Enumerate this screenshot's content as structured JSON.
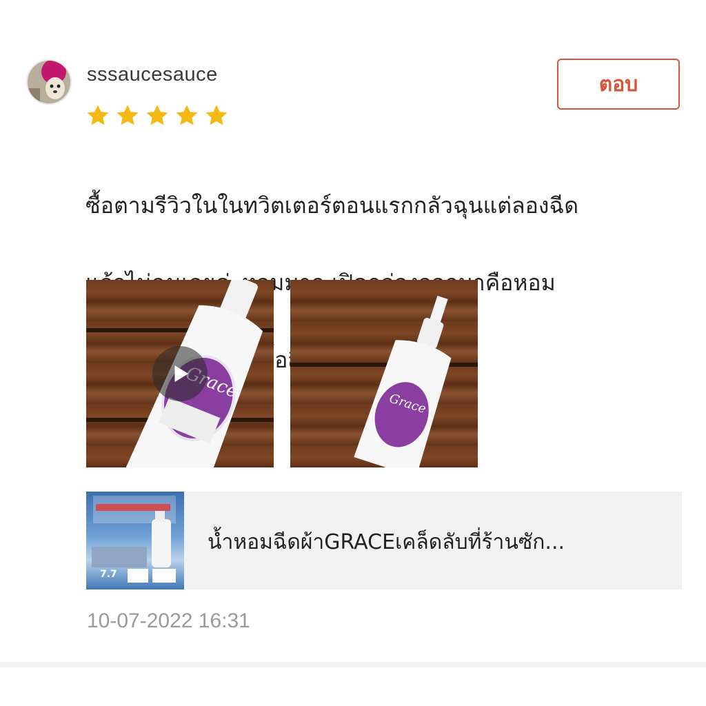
{
  "review": {
    "username": "sssaucesauce",
    "reply_label": "ตอบ",
    "rating": 5,
    "star_color": "#f5b914",
    "text_lines": [
      "ซื้อตามรีวิวในในทวิตเตอร์ตอนแรกกลัวฉุนแต่ลองฉีด",
      "แล้วไม่ฉุนเลยค่ะหอมมาก เปิดกล่องออกมาคือหอม",
      "เลย ไว้เดี๋ยวจะลองซื้อสีอื่นมาลองใช้ดูค่ะ"
    ],
    "media": [
      {
        "type": "video",
        "icon": "play-icon",
        "label_brand": "Grace"
      },
      {
        "type": "image",
        "label_brand": "Grace"
      }
    ],
    "product": {
      "title": "น้ำหอมฉีดผ้าGRACEเคล็ดลับที่ร้านซัก...",
      "thumb_badge": "7.7"
    },
    "timestamp": "10-07-2022 16:31"
  },
  "colors": {
    "accent": "#d9543a",
    "text": "#222222",
    "muted": "#9a9a9a"
  }
}
